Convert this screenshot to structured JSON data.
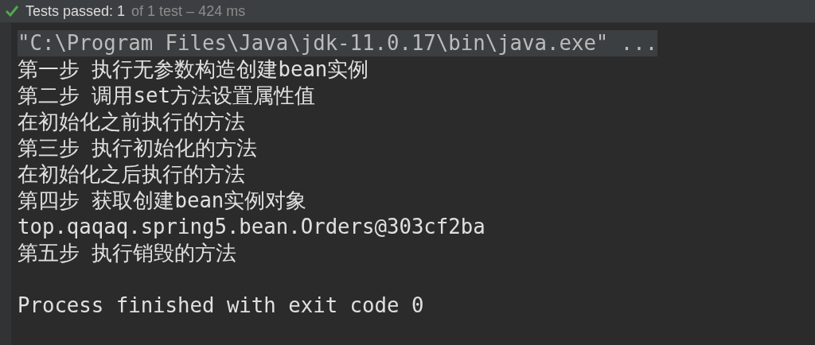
{
  "status_bar": {
    "passed": true,
    "summary": "Tests passed: 1",
    "detail": "of 1 test – 424 ms"
  },
  "console": {
    "lines": [
      {
        "kind": "command",
        "text": "\"C:\\Program Files\\Java\\jdk-11.0.17\\bin\\java.exe\" ..."
      },
      {
        "kind": "output",
        "text": "第一步 执行无参数构造创建bean实例"
      },
      {
        "kind": "output",
        "text": "第二步 调用set方法设置属性值"
      },
      {
        "kind": "output",
        "text": "在初始化之前执行的方法"
      },
      {
        "kind": "output",
        "text": "第三步 执行初始化的方法"
      },
      {
        "kind": "output",
        "text": "在初始化之后执行的方法"
      },
      {
        "kind": "output",
        "text": "第四步 获取创建bean实例对象"
      },
      {
        "kind": "output",
        "text": "top.qaqaq.spring5.bean.Orders@303cf2ba"
      },
      {
        "kind": "output",
        "text": "第五步 执行销毁的方法"
      },
      {
        "kind": "exit",
        "text": "Process finished with exit code 0"
      }
    ]
  }
}
